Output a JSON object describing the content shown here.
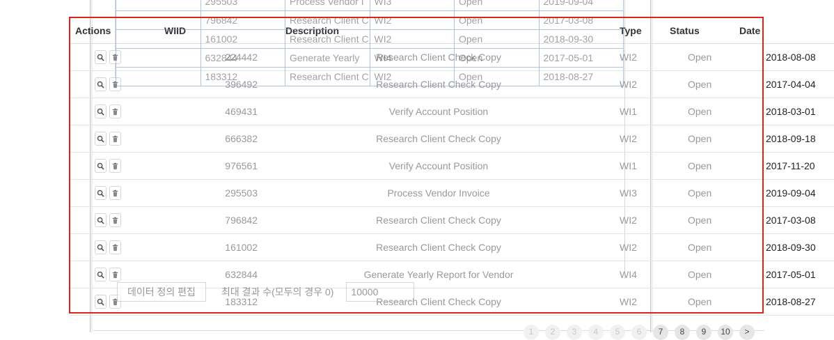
{
  "table": {
    "headers": {
      "actions": "Actions",
      "wiid": "WIID",
      "description": "Description",
      "type": "Type",
      "status": "Status",
      "date": "Date"
    },
    "rows": [
      {
        "wiid": "224442",
        "description": "Research Client Check Copy",
        "type": "WI2",
        "status": "Open",
        "date": "2018-08-08"
      },
      {
        "wiid": "396492",
        "description": "Research Client Check Copy",
        "type": "WI2",
        "status": "Open",
        "date": "2017-04-04"
      },
      {
        "wiid": "469431",
        "description": "Verify Account Position",
        "type": "WI1",
        "status": "Open",
        "date": "2018-03-01"
      },
      {
        "wiid": "666382",
        "description": "Research Client Check Copy",
        "type": "WI2",
        "status": "Open",
        "date": "2018-09-18"
      },
      {
        "wiid": "976561",
        "description": "Verify Account Position",
        "type": "WI1",
        "status": "Open",
        "date": "2017-11-20"
      },
      {
        "wiid": "295503",
        "description": "Process Vendor Invoice",
        "type": "WI3",
        "status": "Open",
        "date": "2019-09-04"
      },
      {
        "wiid": "796842",
        "description": "Research Client Check Copy",
        "type": "WI2",
        "status": "Open",
        "date": "2017-03-08"
      },
      {
        "wiid": "161002",
        "description": "Research Client Check Copy",
        "type": "WI2",
        "status": "Open",
        "date": "2018-09-30"
      },
      {
        "wiid": "632844",
        "description": "Generate Yearly Report for Vendor",
        "type": "WI4",
        "status": "Open",
        "date": "2017-05-01"
      },
      {
        "wiid": "183312",
        "description": "Research Client Check Copy",
        "type": "WI2",
        "status": "Open",
        "date": "2018-08-27"
      }
    ]
  },
  "overlay_table": {
    "rows": [
      [
        "",
        "295503",
        "Process Vendor I",
        "WI3",
        "Open",
        "2019-09-04"
      ],
      [
        "",
        "796842",
        "Research Client C",
        "WI2",
        "Open",
        "2017-03-08"
      ],
      [
        "",
        "161002",
        "Research Client C",
        "WI2",
        "Open",
        "2018-09-30"
      ],
      [
        "",
        "632844",
        "Generate Yearly",
        "WI4",
        "Open",
        "2017-05-01"
      ],
      [
        "",
        "183312",
        "Research Client C",
        "WI2",
        "Open",
        "2018-08-27"
      ]
    ]
  },
  "overlay_controls": {
    "edit_definition_label": "데이터 정의 편집",
    "max_results_label": "최대 결과 수(모두의 경우 0)",
    "max_results_value": "10000"
  },
  "pagination": {
    "pages": [
      "1",
      "2",
      "3",
      "4",
      "5",
      "6",
      "7",
      "8",
      "9",
      "10",
      ">"
    ],
    "dimmed_count": 6
  },
  "icons": {
    "view": "magnifier-icon",
    "delete": "trash-icon"
  },
  "colors": {
    "highlight": "#d9261c",
    "overlay_grid": "#6f93bd"
  }
}
